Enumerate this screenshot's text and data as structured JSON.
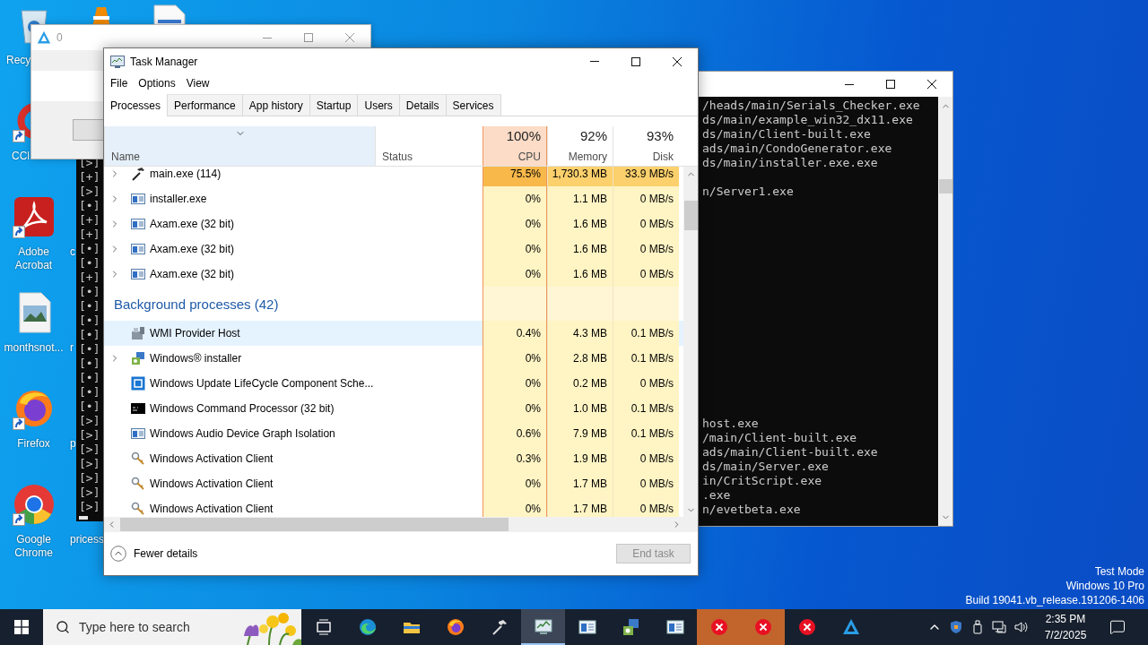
{
  "desktop_icons": [
    {
      "label": "Recy",
      "kind": "recycle-bin"
    },
    {
      "label": "CCl",
      "kind": "ccleaner",
      "shortcut": true
    },
    {
      "label": "Adobe Acrobat",
      "kind": "acrobat",
      "shortcut": true
    },
    {
      "label": "monthsnot...",
      "kind": "image-file"
    },
    {
      "label": "Firefox",
      "kind": "firefox",
      "shortcut": true
    },
    {
      "label": "Google Chrome",
      "kind": "chrome",
      "shortcut": true
    },
    {
      "kind": "vlc"
    },
    {
      "label": "c"
    },
    {
      "label": "r"
    },
    {
      "label": "p"
    },
    {
      "label": "pricess"
    },
    {
      "kind": "document"
    }
  ],
  "dialog_window": {
    "title": "0"
  },
  "left_console": {
    "lines": [
      "[>]",
      "[+]",
      "[>]",
      "[•]",
      "[+]",
      "[+]",
      "[•]",
      "[•]",
      "[+]",
      "[•]",
      "[•]",
      "[•]",
      "[•]",
      "[•]",
      "[•]",
      "[•]",
      "[•]",
      "[•]",
      "[>]",
      "[>]",
      "[>]",
      "[>]",
      "[>]",
      "[>]",
      "[>]"
    ]
  },
  "right_console": {
    "blocks": [
      [
        "/heads/main/Serials_Checker.exe",
        "ds/main/example_win32_dx11.exe",
        "ds/main/Client-built.exe",
        "ads/main/CondoGenerator.exe",
        "ds/main/installer.exe.exe"
      ],
      [
        "n/Server1.exe"
      ],
      [
        "host.exe",
        "/main/Client-built.exe",
        "ads/main/Client-built.exe",
        "ds/main/Server.exe",
        "in/CritScript.exe",
        ".exe",
        "n/evetbeta.exe"
      ]
    ]
  },
  "task_manager": {
    "title": "Task Manager",
    "menu": [
      "File",
      "Options",
      "View"
    ],
    "tabs": [
      {
        "label": "Processes",
        "selected": true
      },
      {
        "label": "Performance",
        "selected": false
      },
      {
        "label": "App history",
        "selected": false
      },
      {
        "label": "Startup",
        "selected": false
      },
      {
        "label": "Users",
        "selected": false
      },
      {
        "label": "Details",
        "selected": false
      },
      {
        "label": "Services",
        "selected": false
      }
    ],
    "columns": [
      {
        "label": "Name",
        "sorted": true
      },
      {
        "label": "Status",
        "sorted": false
      },
      {
        "label": "CPU",
        "usage": "100%",
        "hot": true,
        "sorted": false
      },
      {
        "label": "Memory",
        "usage": "92%",
        "hot": false,
        "sorted": false
      },
      {
        "label": "Disk",
        "usage": "93%",
        "hot": false,
        "sorted": false
      }
    ],
    "rows": [
      {
        "kind": "hammer",
        "name": "main.exe (114)",
        "expandable": true,
        "selected": false,
        "hot": true,
        "cpu": "75.5%",
        "memory": "1,730.3 MB",
        "disk": "33.9 MB/s"
      },
      {
        "kind": "window",
        "name": "installer.exe",
        "expandable": true,
        "selected": false,
        "hot": false,
        "cpu": "0%",
        "memory": "1.1 MB",
        "disk": "0 MB/s"
      },
      {
        "kind": "window",
        "name": "Axam.exe (32 bit)",
        "expandable": true,
        "selected": false,
        "hot": false,
        "cpu": "0%",
        "memory": "1.6 MB",
        "disk": "0 MB/s"
      },
      {
        "kind": "window",
        "name": "Axam.exe (32 bit)",
        "expandable": true,
        "selected": false,
        "hot": false,
        "cpu": "0%",
        "memory": "1.6 MB",
        "disk": "0 MB/s"
      },
      {
        "kind": "window",
        "name": "Axam.exe (32 bit)",
        "expandable": true,
        "selected": false,
        "hot": false,
        "cpu": "0%",
        "memory": "1.6 MB",
        "disk": "0 MB/s"
      },
      {
        "kind": "group",
        "name": "Background processes (42)"
      },
      {
        "kind": "wmi",
        "name": "WMI Provider Host",
        "expandable": false,
        "selected": true,
        "hot": false,
        "cpu": "0.4%",
        "memory": "4.3 MB",
        "disk": "0.1 MB/s"
      },
      {
        "kind": "installer",
        "name": "Windows® installer",
        "expandable": true,
        "selected": false,
        "hot": false,
        "cpu": "0%",
        "memory": "2.8 MB",
        "disk": "0.1 MB/s"
      },
      {
        "kind": "update",
        "name": "Windows Update LifeCycle Component Sche...",
        "expandable": false,
        "selected": false,
        "hot": false,
        "cpu": "0%",
        "memory": "0.2 MB",
        "disk": "0 MB/s"
      },
      {
        "kind": "cmd",
        "name": "Windows Command Processor (32 bit)",
        "expandable": false,
        "selected": false,
        "hot": false,
        "cpu": "0%",
        "memory": "1.0 MB",
        "disk": "0.1 MB/s"
      },
      {
        "kind": "window",
        "name": "Windows Audio Device Graph Isolation",
        "expandable": false,
        "selected": false,
        "hot": false,
        "cpu": "0.6%",
        "memory": "7.9 MB",
        "disk": "0.1 MB/s"
      },
      {
        "kind": "keys",
        "name": "Windows Activation Client",
        "expandable": false,
        "selected": false,
        "hot": false,
        "cpu": "0.3%",
        "memory": "1.9 MB",
        "disk": "0 MB/s"
      },
      {
        "kind": "keys",
        "name": "Windows Activation Client",
        "expandable": false,
        "selected": false,
        "hot": false,
        "cpu": "0%",
        "memory": "1.7 MB",
        "disk": "0 MB/s"
      },
      {
        "kind": "keys",
        "name": "Windows Activation Client",
        "expandable": false,
        "selected": false,
        "hot": false,
        "cpu": "0%",
        "memory": "1.7 MB",
        "disk": "0 MB/s"
      }
    ],
    "footer": {
      "toggle": "Fewer details",
      "end_task": {
        "label": "End task",
        "disabled": true
      }
    }
  },
  "system_info": [
    "Test Mode",
    "Windows 10 Pro",
    "Build 19041.vb_release.191206-1406"
  ],
  "taskbar": {
    "search": {
      "placeholder": "Type here to search"
    },
    "apps": [
      {
        "kind": "task-view",
        "selected": false,
        "flashing": false
      },
      {
        "kind": "edge",
        "selected": false,
        "flashing": false
      },
      {
        "kind": "explorer",
        "selected": false,
        "flashing": false
      },
      {
        "kind": "firefox",
        "selected": false,
        "flashing": false
      },
      {
        "kind": "hammer",
        "selected": false,
        "flashing": false
      },
      {
        "kind": "taskmgr",
        "selected": true,
        "flashing": false
      },
      {
        "kind": "app-window",
        "selected": false,
        "flashing": false
      },
      {
        "kind": "installer",
        "selected": false,
        "flashing": false
      },
      {
        "kind": "app-window",
        "selected": false,
        "flashing": false
      },
      {
        "kind": "error",
        "selected": false,
        "flashing": true
      },
      {
        "kind": "error",
        "selected": false,
        "flashing": true
      },
      {
        "kind": "error",
        "selected": false,
        "flashing": false
      },
      {
        "kind": "axam",
        "selected": false,
        "flashing": false
      }
    ],
    "tray": {
      "time": "2:35 PM",
      "date": "7/2/2025"
    }
  }
}
